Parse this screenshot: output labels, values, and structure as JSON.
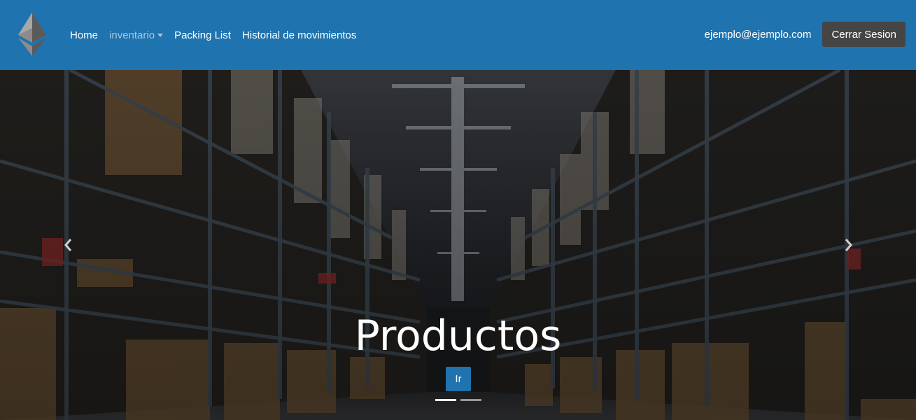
{
  "navbar": {
    "brand_icon": "ethereum-logo-icon",
    "links": [
      {
        "label": "Home"
      },
      {
        "label": "inventario"
      },
      {
        "label": "Packing List"
      },
      {
        "label": "Historial de movimientos"
      }
    ],
    "user_email": "ejemplo@ejemplo.com",
    "logout_label": "Cerrar Sesion",
    "colors": {
      "background": "#1f73ae",
      "logout_button": "#454545",
      "muted_link": "#a9c6df"
    }
  },
  "carousel": {
    "caption_title": "Productos",
    "button_label": "Ir",
    "prev_icon": "chevron-left-icon",
    "next_icon": "chevron-right-icon",
    "slide_count": 2,
    "active_slide": 1
  }
}
